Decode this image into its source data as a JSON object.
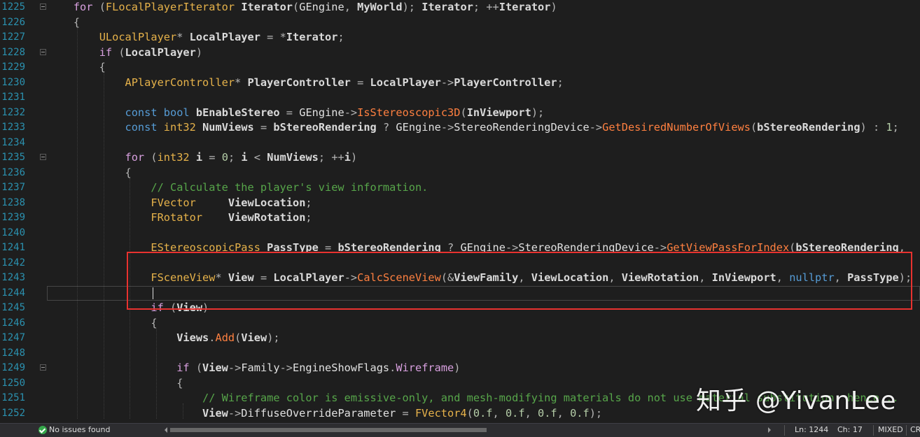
{
  "lines": [
    {
      "no": "1225",
      "fold": true,
      "tokens": [
        [
          "    ",
          "plain"
        ],
        [
          "for",
          "kw2"
        ],
        [
          " (",
          "punc"
        ],
        [
          "FLocalPlayerIterator",
          "type"
        ],
        [
          " ",
          "plain"
        ],
        [
          "Iterator",
          "var"
        ],
        [
          "(",
          "punc"
        ],
        [
          "GEngine",
          "mem"
        ],
        [
          ", ",
          "punc"
        ],
        [
          "MyWorld",
          "var"
        ],
        [
          "); ",
          "punc"
        ],
        [
          "Iterator",
          "var"
        ],
        [
          "; ++",
          "punc"
        ],
        [
          "Iterator",
          "var"
        ],
        [
          ")",
          "punc"
        ]
      ]
    },
    {
      "no": "1226",
      "tokens": [
        [
          "    {",
          "punc"
        ]
      ]
    },
    {
      "no": "1227",
      "tokens": [
        [
          "        ",
          "plain"
        ],
        [
          "ULocalPlayer",
          "type"
        ],
        [
          "* ",
          "punc"
        ],
        [
          "LocalPlayer",
          "var"
        ],
        [
          " = *",
          "punc"
        ],
        [
          "Iterator",
          "var"
        ],
        [
          ";",
          "punc"
        ]
      ]
    },
    {
      "no": "1228",
      "fold": true,
      "tokens": [
        [
          "        ",
          "plain"
        ],
        [
          "if",
          "kw2"
        ],
        [
          " (",
          "punc"
        ],
        [
          "LocalPlayer",
          "var"
        ],
        [
          ")",
          "punc"
        ]
      ]
    },
    {
      "no": "1229",
      "tokens": [
        [
          "        {",
          "punc"
        ]
      ]
    },
    {
      "no": "1230",
      "tokens": [
        [
          "            ",
          "plain"
        ],
        [
          "APlayerController",
          "type"
        ],
        [
          "* ",
          "punc"
        ],
        [
          "PlayerController",
          "var"
        ],
        [
          " = ",
          "punc"
        ],
        [
          "LocalPlayer",
          "var"
        ],
        [
          "->",
          "punc"
        ],
        [
          "PlayerController",
          "var"
        ],
        [
          ";",
          "punc"
        ]
      ]
    },
    {
      "no": "1231",
      "tokens": []
    },
    {
      "no": "1232",
      "tokens": [
        [
          "            ",
          "plain"
        ],
        [
          "const",
          "kw"
        ],
        [
          " ",
          "plain"
        ],
        [
          "bool",
          "kw"
        ],
        [
          " ",
          "plain"
        ],
        [
          "bEnableStereo",
          "var"
        ],
        [
          " = ",
          "punc"
        ],
        [
          "GEngine",
          "mem"
        ],
        [
          "->",
          "punc"
        ],
        [
          "IsStereoscopic3D",
          "fn"
        ],
        [
          "(",
          "punc"
        ],
        [
          "InViewport",
          "var"
        ],
        [
          ");",
          "punc"
        ]
      ]
    },
    {
      "no": "1233",
      "tokens": [
        [
          "            ",
          "plain"
        ],
        [
          "const",
          "kw"
        ],
        [
          " ",
          "plain"
        ],
        [
          "int32",
          "type"
        ],
        [
          " ",
          "plain"
        ],
        [
          "NumViews",
          "var"
        ],
        [
          " = ",
          "punc"
        ],
        [
          "bStereoRendering",
          "var"
        ],
        [
          " ? ",
          "punc"
        ],
        [
          "GEngine",
          "mem"
        ],
        [
          "->",
          "punc"
        ],
        [
          "StereoRenderingDevice",
          "mem"
        ],
        [
          "->",
          "punc"
        ],
        [
          "GetDesiredNumberOfViews",
          "fn"
        ],
        [
          "(",
          "punc"
        ],
        [
          "bStereoRendering",
          "var"
        ],
        [
          ") : ",
          "punc"
        ],
        [
          "1",
          "num"
        ],
        [
          ";",
          "punc"
        ]
      ]
    },
    {
      "no": "1234",
      "tokens": []
    },
    {
      "no": "1235",
      "fold": true,
      "tokens": [
        [
          "            ",
          "plain"
        ],
        [
          "for",
          "kw2"
        ],
        [
          " (",
          "punc"
        ],
        [
          "int32",
          "type"
        ],
        [
          " ",
          "plain"
        ],
        [
          "i",
          "var"
        ],
        [
          " = ",
          "punc"
        ],
        [
          "0",
          "num"
        ],
        [
          "; ",
          "punc"
        ],
        [
          "i",
          "var"
        ],
        [
          " < ",
          "punc"
        ],
        [
          "NumViews",
          "var"
        ],
        [
          "; ++",
          "punc"
        ],
        [
          "i",
          "var"
        ],
        [
          ")",
          "punc"
        ]
      ]
    },
    {
      "no": "1236",
      "tokens": [
        [
          "            {",
          "punc"
        ]
      ]
    },
    {
      "no": "1237",
      "tokens": [
        [
          "                ",
          "plain"
        ],
        [
          "// Calculate the player's view information.",
          "cm"
        ]
      ]
    },
    {
      "no": "1238",
      "tokens": [
        [
          "                ",
          "plain"
        ],
        [
          "FVector",
          "type"
        ],
        [
          "     ",
          "plain"
        ],
        [
          "ViewLocation",
          "var"
        ],
        [
          ";",
          "punc"
        ]
      ]
    },
    {
      "no": "1239",
      "tokens": [
        [
          "                ",
          "plain"
        ],
        [
          "FRotator",
          "type"
        ],
        [
          "    ",
          "plain"
        ],
        [
          "ViewRotation",
          "var"
        ],
        [
          ";",
          "punc"
        ]
      ]
    },
    {
      "no": "1240",
      "tokens": []
    },
    {
      "no": "1241",
      "tokens": [
        [
          "                ",
          "plain"
        ],
        [
          "EStereoscopicPass",
          "type"
        ],
        [
          " ",
          "plain"
        ],
        [
          "PassType",
          "var"
        ],
        [
          " = ",
          "punc"
        ],
        [
          "bStereoRendering",
          "var"
        ],
        [
          " ? ",
          "punc"
        ],
        [
          "GEngine",
          "mem"
        ],
        [
          "->",
          "punc"
        ],
        [
          "StereoRenderingDevice",
          "mem"
        ],
        [
          "->",
          "punc"
        ],
        [
          "GetViewPassForIndex",
          "fn"
        ],
        [
          "(",
          "punc"
        ],
        [
          "bStereoRendering",
          "var"
        ],
        [
          ", ",
          "punc"
        ]
      ]
    },
    {
      "no": "1242",
      "tokens": []
    },
    {
      "no": "1243",
      "tokens": [
        [
          "                ",
          "plain"
        ],
        [
          "FSceneView",
          "type"
        ],
        [
          "* ",
          "punc"
        ],
        [
          "View",
          "var"
        ],
        [
          " = ",
          "punc"
        ],
        [
          "LocalPlayer",
          "var"
        ],
        [
          "->",
          "punc"
        ],
        [
          "CalcSceneView",
          "fn"
        ],
        [
          "(&",
          "punc"
        ],
        [
          "ViewFamily",
          "var"
        ],
        [
          ", ",
          "punc"
        ],
        [
          "ViewLocation",
          "var"
        ],
        [
          ", ",
          "punc"
        ],
        [
          "ViewRotation",
          "var"
        ],
        [
          ", ",
          "punc"
        ],
        [
          "InViewport",
          "var"
        ],
        [
          ", ",
          "punc"
        ],
        [
          "nullptr",
          "kw"
        ],
        [
          ", ",
          "punc"
        ],
        [
          "PassType",
          "var"
        ],
        [
          ");",
          "punc"
        ]
      ]
    },
    {
      "no": "1244",
      "tokens": []
    },
    {
      "no": "1245",
      "tokens": [
        [
          "                ",
          "plain"
        ],
        [
          "if",
          "kw2"
        ],
        [
          " (",
          "punc"
        ],
        [
          "View",
          "var"
        ],
        [
          ")",
          "punc"
        ]
      ]
    },
    {
      "no": "1246",
      "tokens": [
        [
          "                {",
          "punc"
        ]
      ]
    },
    {
      "no": "1247",
      "tokens": [
        [
          "                    ",
          "plain"
        ],
        [
          "Views",
          "var"
        ],
        [
          ".",
          "punc"
        ],
        [
          "Add",
          "fn"
        ],
        [
          "(",
          "punc"
        ],
        [
          "View",
          "var"
        ],
        [
          ");",
          "punc"
        ]
      ]
    },
    {
      "no": "1248",
      "tokens": []
    },
    {
      "no": "1249",
      "fold": true,
      "tokens": [
        [
          "                    ",
          "plain"
        ],
        [
          "if",
          "kw2"
        ],
        [
          " (",
          "punc"
        ],
        [
          "View",
          "var"
        ],
        [
          "->",
          "punc"
        ],
        [
          "Family",
          "mem"
        ],
        [
          "->",
          "punc"
        ],
        [
          "EngineShowFlags",
          "mem"
        ],
        [
          ".",
          "punc"
        ],
        [
          "Wireframe",
          "field"
        ],
        [
          ")",
          "punc"
        ]
      ]
    },
    {
      "no": "1250",
      "tokens": [
        [
          "                    {",
          "punc"
        ]
      ]
    },
    {
      "no": "1251",
      "tokens": [
        [
          "                        ",
          "plain"
        ],
        [
          "// Wireframe color is emissive-only, and mesh-modifying materials do not use material substitution, hence...",
          "cm"
        ]
      ]
    },
    {
      "no": "1252",
      "tokens": [
        [
          "                        ",
          "plain"
        ],
        [
          "View",
          "var"
        ],
        [
          "->",
          "punc"
        ],
        [
          "DiffuseOverrideParameter",
          "mem"
        ],
        [
          " = ",
          "punc"
        ],
        [
          "FVector4",
          "type"
        ],
        [
          "(",
          "punc"
        ],
        [
          "0.f",
          "num"
        ],
        [
          ", ",
          "punc"
        ],
        [
          "0.f",
          "num"
        ],
        [
          ", ",
          "punc"
        ],
        [
          "0.f",
          "num"
        ],
        [
          ", ",
          "punc"
        ],
        [
          "0.f",
          "num"
        ],
        [
          ");",
          "punc"
        ]
      ]
    }
  ],
  "watermark": "知乎 @YivanLee",
  "status": {
    "issues": "No issues found",
    "line": "Ln: 1244",
    "col": "Ch: 17",
    "eol": "MIXED",
    "encoding": "CR"
  },
  "colors": {
    "background": "#1e1e1e",
    "line_number": "#2b91af",
    "keyword": "#569cd6",
    "control_keyword": "#d8a0df",
    "type": "#e6b24a",
    "function": "#ff8040",
    "comment": "#57a64a",
    "highlight_box": "#e8322f"
  }
}
